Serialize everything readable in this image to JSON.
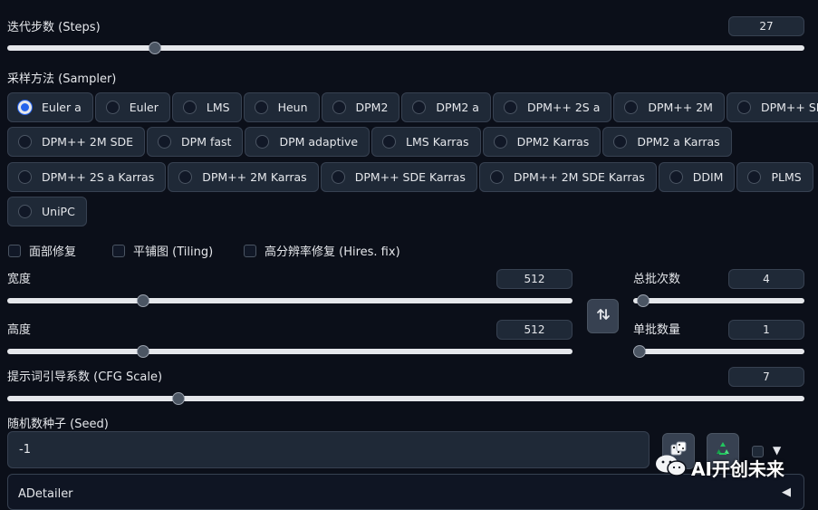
{
  "steps": {
    "label": "迭代步数 (Steps)",
    "value": "27",
    "level": 0.18
  },
  "sampler": {
    "label": "采样方法 (Sampler)",
    "selected": "Euler a",
    "options": [
      "Euler a",
      "Euler",
      "LMS",
      "Heun",
      "DPM2",
      "DPM2 a",
      "DPM++ 2S a",
      "DPM++ 2M",
      "DPM++ SDE",
      "DPM++ 2M SDE",
      "DPM fast",
      "DPM adaptive",
      "LMS Karras",
      "DPM2 Karras",
      "DPM2 a Karras",
      "DPM++ 2S a Karras",
      "DPM++ 2M Karras",
      "DPM++ SDE Karras",
      "DPM++ 2M SDE Karras",
      "DDIM",
      "PLMS",
      "UniPC"
    ]
  },
  "checks": {
    "face": "面部修复",
    "tiling": "平铺图 (Tiling)",
    "hires": "高分辨率修复 (Hires. fix)"
  },
  "width": {
    "label": "宽度",
    "value": "512",
    "level": 0.235
  },
  "height": {
    "label": "高度",
    "value": "512",
    "level": 0.235
  },
  "batch_count": {
    "label": "总批次数",
    "value": "4",
    "level": 0.02
  },
  "batch_size": {
    "label": "单批数量",
    "value": "1",
    "level": 0.0
  },
  "cfg": {
    "label": "提示词引导系数 (CFG Scale)",
    "value": "7",
    "level": 0.21
  },
  "seed": {
    "label": "随机数种子 (Seed)",
    "value": "-1"
  },
  "adetailer": {
    "label": "ADetailer",
    "arrow": "◀"
  },
  "watermark": {
    "text": "AI开创未来"
  },
  "icons": {
    "swap": "swap-arrows-icon",
    "dice": "dice-icon",
    "recycle": "recycle-icon",
    "wechat": "wechat-logo-icon"
  }
}
